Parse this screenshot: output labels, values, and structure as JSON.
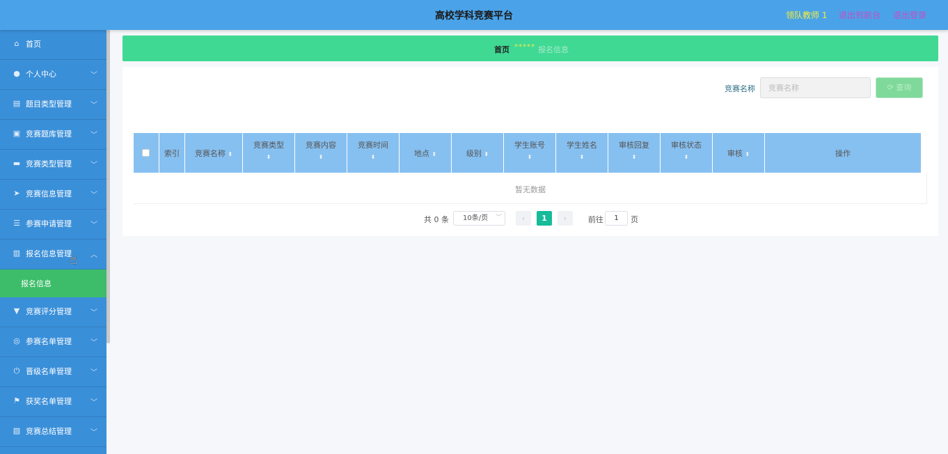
{
  "header": {
    "title": "高校学科竞赛平台",
    "user_label": "领队教师 1",
    "to_front_label": "退出到前台",
    "logout_label": "退出登录"
  },
  "sidebar": {
    "items": [
      {
        "label": "首页",
        "icon": "home-icon",
        "glyph": "⌂",
        "chevron": ""
      },
      {
        "label": "个人中心",
        "icon": "user-icon",
        "glyph": "●",
        "chevron": "﹀"
      },
      {
        "label": "题目类型管理",
        "icon": "clipboard-icon",
        "glyph": "▤",
        "chevron": "﹀"
      },
      {
        "label": "竞赛题库管理",
        "icon": "image-icon",
        "glyph": "▣",
        "chevron": "﹀"
      },
      {
        "label": "竞赛类型管理",
        "icon": "monitor-icon",
        "glyph": "▬",
        "chevron": "﹀"
      },
      {
        "label": "竞赛信息管理",
        "icon": "send-icon",
        "glyph": "➤",
        "chevron": "﹀"
      },
      {
        "label": "参赛申请管理",
        "icon": "list-icon",
        "glyph": "☰",
        "chevron": "﹀"
      },
      {
        "label": "报名信息管理",
        "icon": "bar-chart-icon",
        "glyph": "▥",
        "chevron": "︿"
      },
      {
        "label": "竞赛评分管理",
        "icon": "pin-icon",
        "glyph": "▼",
        "chevron": "﹀"
      },
      {
        "label": "参赛名单管理",
        "icon": "globe-icon",
        "glyph": "◎",
        "chevron": "﹀"
      },
      {
        "label": "晋级名单管理",
        "icon": "power-icon",
        "glyph": "⏻",
        "chevron": "﹀"
      },
      {
        "label": "获奖名单管理",
        "icon": "flag-icon",
        "glyph": "⚑",
        "chevron": "﹀"
      },
      {
        "label": "竞赛总结管理",
        "icon": "clipboard-check-icon",
        "glyph": "▧",
        "chevron": "﹀"
      }
    ],
    "submenu_label": "报名信息"
  },
  "breadcrumb": {
    "home": "首页",
    "separator": "*****",
    "current": "报名信息"
  },
  "search": {
    "label": "竞赛名称",
    "placeholder": "竞赛名称",
    "button_label": "⟳ 查询"
  },
  "table": {
    "headers": [
      "索引",
      "竞赛名称",
      "竞赛类型",
      "竞赛内容",
      "竞赛时间",
      "地点",
      "级别",
      "学生账号",
      "学生姓名",
      "审核回复",
      "审核状态",
      "审核",
      "操作"
    ],
    "empty_text": "暂无数据"
  },
  "pagination": {
    "total": "共 0 条",
    "page_size": "10条/页",
    "current_page": "1",
    "goto_label": "前往",
    "goto_value": "1",
    "page_unit": "页"
  }
}
